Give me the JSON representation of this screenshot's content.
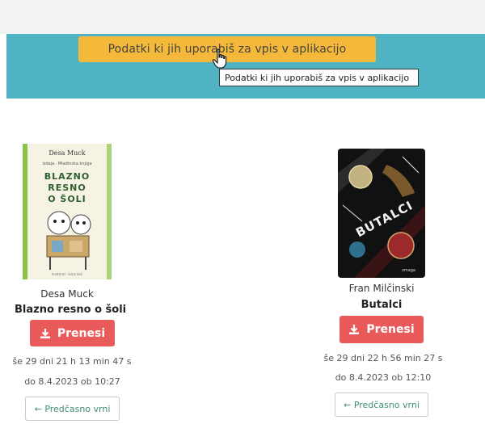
{
  "header": {
    "info_button_label": "Podatki ki jih uporabiš za vpis v aplikacijo",
    "tooltip_text": "Podatki ki jih uporabiš za vpis v aplikacijo",
    "band_color": "#4fb3c3",
    "info_button_color": "#f4b93a"
  },
  "books": [
    {
      "author": "Desa Muck",
      "title": "Blazno resno o šoli",
      "cover_icon": "book-cover-illustration",
      "download_label": "Prenesi",
      "time_left": "še 29 dni 21 h 13 min 47 s",
      "expiry": "do 8.4.2023 ob 10:27",
      "return_label": "← Predčasno vrni"
    },
    {
      "author": "Fran Milčinski",
      "title": "Butalci",
      "cover_icon": "book-cover-illustration",
      "download_label": "Prenesi",
      "time_left": "še 29 dni 22 h 56 min 27 s",
      "expiry": "do 8.4.2023 ob 12:10",
      "return_label": "← Predčasno vrni"
    }
  ],
  "colors": {
    "download": "#e95b5b",
    "return_text": "#3f8f6f"
  }
}
